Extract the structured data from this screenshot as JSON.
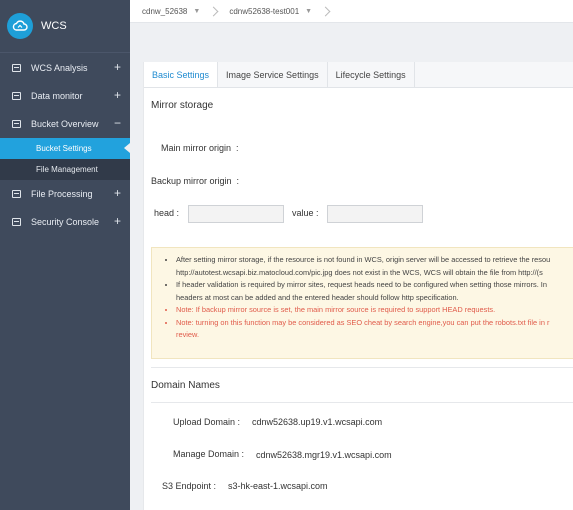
{
  "app": {
    "name": "WCS"
  },
  "sidebar": {
    "items": [
      {
        "label": "WCS Analysis",
        "toggle": "+"
      },
      {
        "label": "Data monitor",
        "toggle": "+"
      },
      {
        "label": "Bucket Overview",
        "toggle": "−"
      },
      {
        "label": "File Processing",
        "toggle": "+"
      },
      {
        "label": "Security Console",
        "toggle": "+"
      }
    ],
    "bucket_sub": [
      {
        "label": "Bucket Settings"
      },
      {
        "label": "File Management"
      }
    ]
  },
  "breadcrumb": [
    {
      "label": "cdnw_52638"
    },
    {
      "label": "cdnw52638-test001"
    }
  ],
  "tabs": [
    {
      "label": "Basic Settings"
    },
    {
      "label": "Image Service Settings"
    },
    {
      "label": "Lifecycle Settings"
    }
  ],
  "mirror": {
    "title": "Mirror storage",
    "main_label": "Main mirror origin",
    "main_colon": ":",
    "backup_label": "Backup mirror origin",
    "backup_colon": ":",
    "head_label": "head :",
    "value_label": "value :",
    "head_value": "",
    "value_value": ""
  },
  "notice": {
    "line1": "After setting mirror storage, if the resource is not found in WCS, origin server will be accessed to retrieve the resou",
    "line1b": "http://autotest.wcsapi.biz.matocloud.com/pic.jpg does not exist in the WCS, WCS will obtain the file from http://(s",
    "line2": "If header validation is required by mirror sites, request heads need to be configured when setting those mirrors. In",
    "line2b": "headers at most can be added and the entered header should follow http specification.",
    "line3": "Note: If backup mirror source is set, the main mirror source is required to support HEAD requests.",
    "line4": "Note: turning on this function may be considered as SEO cheat by search engine,you can put the robots.txt file in r",
    "line4b": "review."
  },
  "domains": {
    "title": "Domain Names",
    "upload_label": "Upload Domain :",
    "upload_value": "cdnw52638.up19.v1.wcsapi.com",
    "manage_label": "Manage Domain :",
    "manage_value": "cdnw52638.mgr19.v1.wcsapi.com",
    "s3_label": "S3 Endpoint :",
    "s3_value": "s3-hk-east-1.wcsapi.com"
  },
  "colors": {
    "sidebar_bg": "#3f4a5c",
    "accent": "#22a2dd",
    "tab_active": "#1f8bd0",
    "note_red": "#e05b4a"
  }
}
